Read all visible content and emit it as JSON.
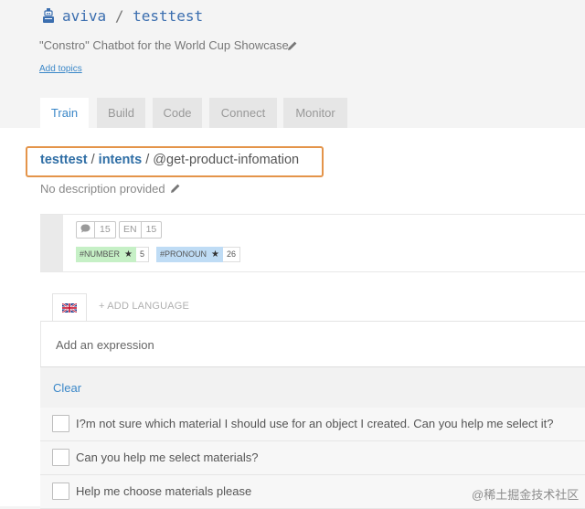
{
  "header": {
    "owner": "aviva",
    "separator": "/",
    "repo": "testtest",
    "description": "\"Constro\" Chatbot for the World Cup Showcase",
    "add_topics": "Add topics"
  },
  "tabs": [
    {
      "label": "Train",
      "active": true
    },
    {
      "label": "Build",
      "active": false
    },
    {
      "label": "Code",
      "active": false
    },
    {
      "label": "Connect",
      "active": false
    },
    {
      "label": "Monitor",
      "active": false
    }
  ],
  "breadcrumb": {
    "root": "testtest",
    "sep1": "/",
    "section": "intents",
    "sep2": "/",
    "current": "@get-product-infomation"
  },
  "intent_description": "No description provided",
  "stats": {
    "expressions_count": "15",
    "language_label": "EN",
    "language_count": "15"
  },
  "entities": [
    {
      "name": "#NUMBER",
      "star": "★",
      "count": "5",
      "color": "#c6f0c6"
    },
    {
      "name": "#PRONOUN",
      "star": "★",
      "count": "26",
      "color": "#bfdcf5"
    }
  ],
  "languages": {
    "current_flag": "uk-flag-icon",
    "add_label": "+ ADD LANGUAGE"
  },
  "expression_input": {
    "placeholder": "Add an expression",
    "value": ""
  },
  "clear_label": "Clear",
  "expressions": [
    "I?m not sure which material I should use for an object I created. Can you help me select it?",
    "Can you help me select materials?",
    "Help me choose materials please"
  ],
  "watermark": "@稀土掘金技术社区",
  "colors": {
    "link": "#3a87c8",
    "highlight_border": "#e4944a"
  }
}
